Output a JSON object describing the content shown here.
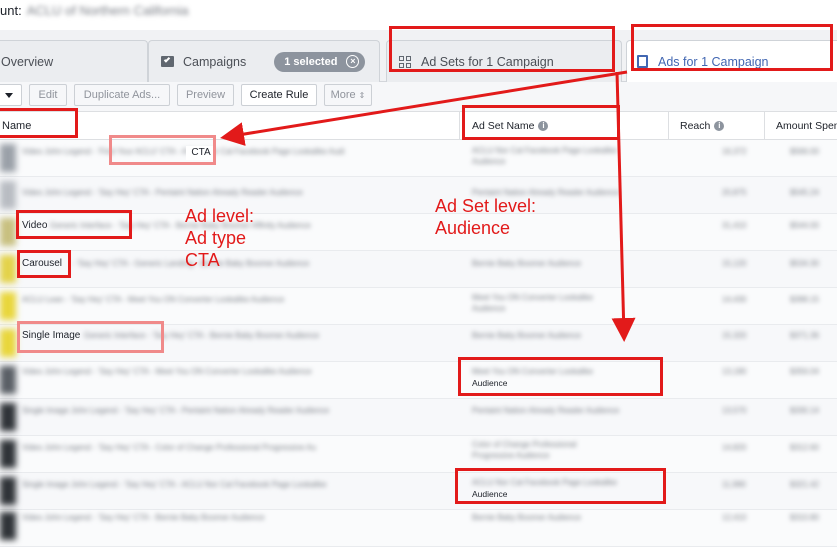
{
  "account": {
    "label": "unt:",
    "name": "ACLU of Northern California"
  },
  "tabs": {
    "overview": "Overview",
    "campaigns": "Campaigns",
    "selected_badge": "1 selected",
    "adsets": "Ad Sets for 1 Campaign",
    "ads": "Ads for 1 Campaign"
  },
  "toolbar": {
    "edit": "Edit",
    "duplicate": "Duplicate Ads...",
    "preview": "Preview",
    "create_rule": "Create Rule",
    "more": "More"
  },
  "table": {
    "col_name": "Name",
    "col_adset": "Ad Set Name",
    "col_reach": "Reach",
    "col_spent": "Amount Spent",
    "cta_label": "CTA",
    "rows": [
      {
        "name_prefix": "",
        "name": "Video John Legend - 'Find Your ACLU' CTA - ACLU Nor Cal Facebook Page Lookalike Audi",
        "adset_line1": "ACLU Nor Cal Facebook Page Lookalike",
        "adset_line2": "Audience",
        "reach": "16,372",
        "spent": "$566.00"
      },
      {
        "name_prefix": "",
        "name": "Video John Legend - 'Say Hey' CTA - Pentaint Nation Already Reader Audience",
        "adset_line1": "Pentaint Nation Already Reader Audience",
        "adset_line2": "",
        "reach": "20,875",
        "spent": "$545.24"
      },
      {
        "name_prefix": "Video",
        "name": "Generic Interface - 'Say Hey' CTA - Bernie Baby Boomer Affinity Audience",
        "adset_line1": "",
        "adset_line2": "",
        "reach": "31,410",
        "spent": "$544.00"
      },
      {
        "name_prefix": "Carousel",
        "name": "- 'Say Hey' CTA - Generic Landing - Bernie Baby Boomer Audience",
        "adset_line1": "Bernie Baby Boomer Audience",
        "adset_line2": "",
        "reach": "15,120",
        "spent": "$534.30"
      },
      {
        "name_prefix": "",
        "name": "ACLU Lean - 'Say Hey' CTA - Meet You ON Converter Lookalike Audience",
        "adset_line1": "Meet You ON Converter Lookalike",
        "adset_line2": "Audience",
        "reach": "14,430",
        "spent": "$398.15"
      },
      {
        "name_prefix": "Single Image",
        "name": "Generic Interface - 'Say Hey' CTA - Bernie Baby Boomer Audience",
        "adset_line1": "Bernie Baby Boomer Audience",
        "adset_line2": "",
        "reach": "15,320",
        "spent": "$371.36"
      },
      {
        "name_prefix": "",
        "name": "Video John Legend - 'Say Hey' CTA - Meet You ON Converter Lookalike Audience",
        "adset_line1": "Meet You ON Converter Lookalike",
        "adset_line2": "Audience",
        "reach": "13,180",
        "spent": "$356.04"
      },
      {
        "name_prefix": "",
        "name": "Single Image John Legend - 'Say Hey' CTA - Pentaint Nation Already Reader Audience",
        "adset_line1": "Pentaint Nation Already Reader Audience",
        "adset_line2": "",
        "reach": "13,570",
        "spent": "$330.14"
      },
      {
        "name_prefix": "",
        "name": "Video John Legend - 'Say Hey' CTA - Color of Change Professional Progressive Au",
        "adset_line1": "Color of Change Professional",
        "adset_line2": "Progressive Audience",
        "reach": "14,820",
        "spent": "$312.60"
      },
      {
        "name_prefix": "",
        "name": "Single Image John Legend - 'Say Hey' CTA - ACLU Nor Cal Facebook Page Lookalike",
        "adset_line1": "ACLU Nor Cal Facebook Page Lookalike",
        "adset_line2": "Audience",
        "reach": "11,990",
        "spent": "$321.42"
      },
      {
        "name_prefix": "",
        "name": "Video John Legend - 'Say Hey' CTA - Bernie Baby Boomer Audience",
        "adset_line1": "Bernie Baby Boomer Audience",
        "adset_line2": "",
        "reach": "12,410",
        "spent": "$310.80"
      }
    ]
  },
  "annotations": {
    "ad_level": [
      "Ad level:",
      "Ad type",
      "CTA"
    ],
    "adset_level": [
      "Ad Set level:",
      "Audience"
    ]
  },
  "colors": {
    "accent_red": "#e21a1a",
    "fb_blue": "#4267b2",
    "badge_gray": "#8d949e"
  }
}
